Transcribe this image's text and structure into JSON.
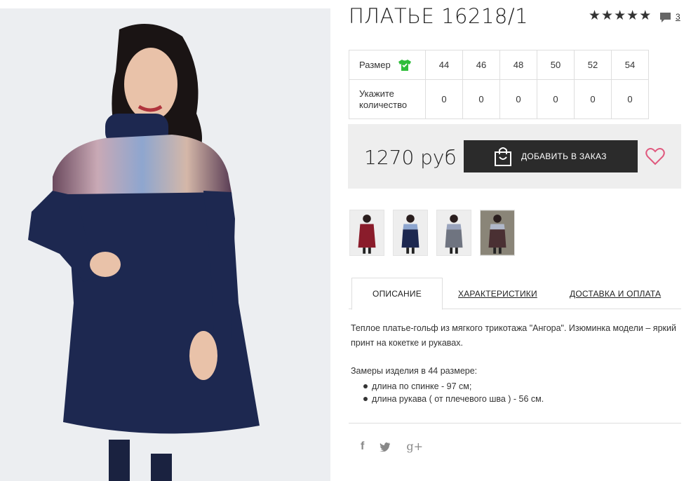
{
  "product": {
    "title": "ПЛАТЬЕ 16218/1",
    "rating_stars": 5,
    "review_count": "3"
  },
  "sizes_table": {
    "size_label": "Размер",
    "qty_label_line1": "Укажите",
    "qty_label_line2": "количество",
    "sizes": [
      "44",
      "46",
      "48",
      "50",
      "52",
      "54"
    ],
    "quantities": [
      "0",
      "0",
      "0",
      "0",
      "0",
      "0"
    ]
  },
  "order": {
    "price": "1270 руб",
    "add_button_label": "ДОБАВИТЬ В ЗАКАЗ"
  },
  "thumbnails": [
    {
      "color_name": "burgundy",
      "color": "#8a1c2b"
    },
    {
      "color_name": "navy",
      "color": "#1d2850"
    },
    {
      "color_name": "grey",
      "color": "#6f7480"
    },
    {
      "color_name": "brown",
      "color": "#4a3033"
    }
  ],
  "tabs": {
    "description": "ОПИСАНИЕ",
    "characteristics": "ХАРАКТЕРИСТИКИ",
    "delivery": "ДОСТАВКА И ОПЛАТА"
  },
  "description": {
    "text": "Теплое платье-гольф из мягкого трикотажа \"Ангора\". Изюминка модели – яркий принт на кокетке и рукавах.",
    "measure_title": "Замеры изделия в 44 размере:",
    "measures": [
      "длина по спинке - 97 см;",
      "длина рукава ( от плечевого шва ) - 56 см."
    ]
  },
  "social": {
    "facebook": "f",
    "twitter": "twitter-icon",
    "gplus": "g+"
  },
  "colors": {
    "dark_button": "#2b2b2b",
    "heart_pink": "#e0597e",
    "size_check_green": "#2ebd3a",
    "price_box_bg": "#eeeeee"
  }
}
